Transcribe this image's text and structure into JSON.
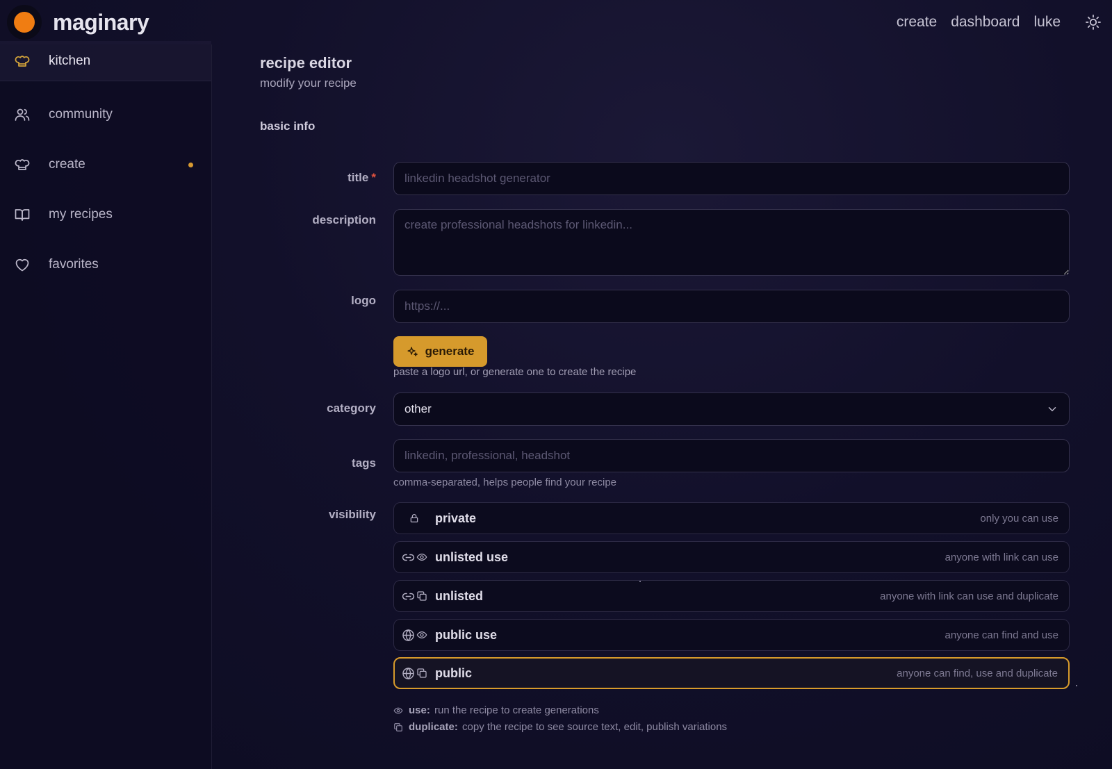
{
  "app": {
    "brand": "maginary",
    "nav": [
      "create",
      "dashboard",
      "luke"
    ],
    "theme_toggle_icon": "sun-icon",
    "accent_color": "#d69a2c",
    "logo_color": "#f07d12"
  },
  "sidebar": {
    "items": [
      {
        "label": "kitchen",
        "icon": "chef-hat-icon",
        "active": true
      },
      {
        "label": "community",
        "icon": "users-icon"
      },
      {
        "label": "create",
        "icon": "chef-hat-icon",
        "has_dot": true
      },
      {
        "label": "my recipes",
        "icon": "book-icon"
      },
      {
        "label": "favorites",
        "icon": "heart-icon"
      }
    ]
  },
  "page": {
    "title": "recipe editor",
    "subtitle": "modify your recipe",
    "section": "basic info"
  },
  "form": {
    "title": {
      "label": "title",
      "required_mark": "*",
      "placeholder": "linkedin headshot generator",
      "value": ""
    },
    "description": {
      "label": "description",
      "placeholder": "create professional headshots for linkedin...",
      "value": ""
    },
    "logo": {
      "label": "logo",
      "placeholder": "https://...",
      "value": "",
      "generate_label": "generate",
      "hint": "paste a logo url, or generate one to create the recipe"
    },
    "category": {
      "label": "category",
      "value": "other"
    },
    "tags": {
      "label": "tags",
      "placeholder": "linkedin, professional, headshot",
      "hint": "comma-separated, helps people find your recipe"
    },
    "visibility": {
      "label": "visibility",
      "selected": "public",
      "options": [
        {
          "name": "private",
          "desc": "only you can use",
          "icons": [
            "lock-icon"
          ]
        },
        {
          "name": "unlisted use",
          "desc": "anyone with link can use",
          "icons": [
            "link-icon",
            "eye-icon"
          ]
        },
        {
          "name": "unlisted",
          "desc": "anyone with link can use and duplicate",
          "icons": [
            "link-icon",
            "copy-icon"
          ]
        },
        {
          "name": "public use",
          "desc": "anyone can find and use",
          "icons": [
            "globe-icon",
            "eye-icon"
          ]
        },
        {
          "name": "public",
          "desc": "anyone can find, use and duplicate",
          "icons": [
            "globe-icon",
            "copy-icon"
          ]
        }
      ]
    },
    "legend": {
      "use_term": "use:",
      "use_text": "run the recipe to create generations",
      "duplicate_term": "duplicate:",
      "duplicate_text": "copy the recipe to see source text, edit, publish variations"
    }
  }
}
